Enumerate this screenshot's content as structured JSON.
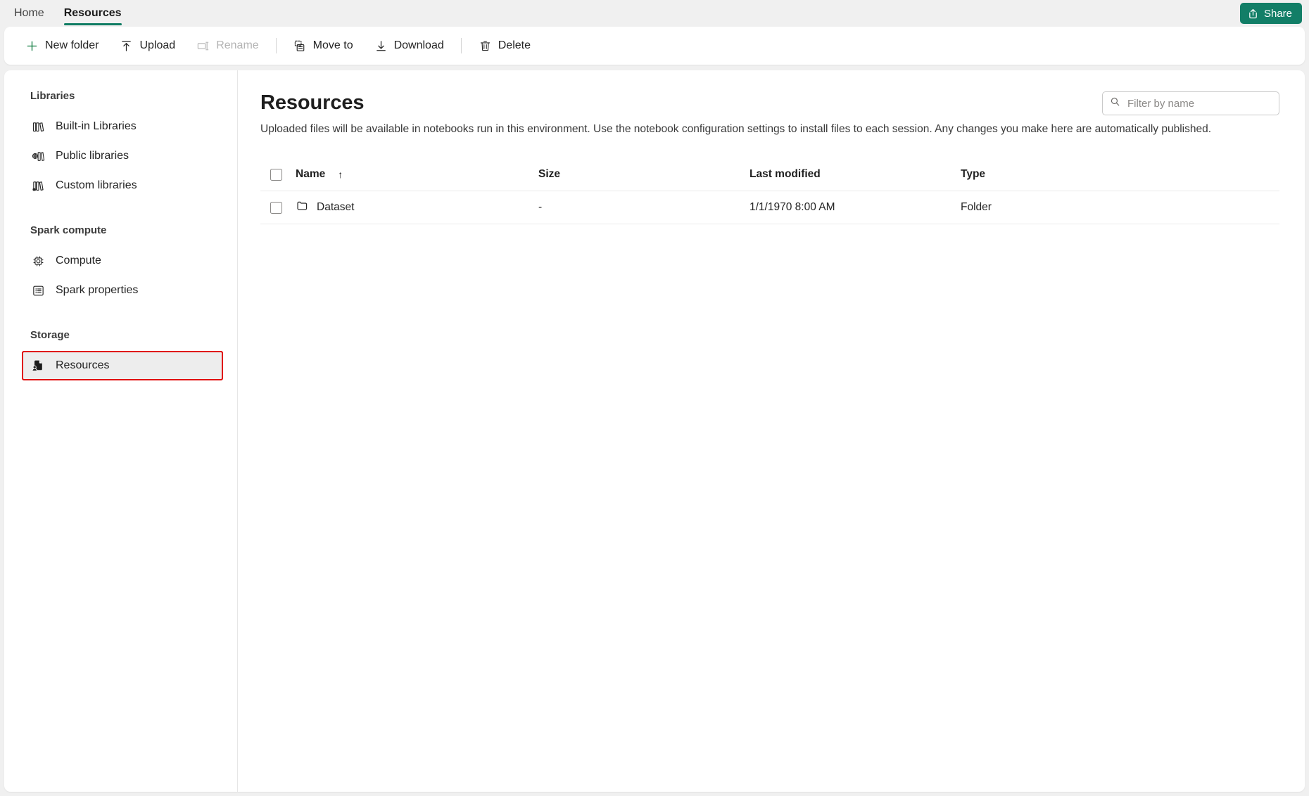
{
  "tabs": [
    {
      "label": "Home",
      "active": false
    },
    {
      "label": "Resources",
      "active": true
    }
  ],
  "share": {
    "label": "Share",
    "icon": "share-icon",
    "color": "#127e67"
  },
  "toolbar": {
    "new_folder": {
      "label": "New folder",
      "icon": "plus-icon",
      "disabled": false
    },
    "upload": {
      "label": "Upload",
      "icon": "upload-icon",
      "disabled": false
    },
    "rename": {
      "label": "Rename",
      "icon": "rename-icon",
      "disabled": true
    },
    "move_to": {
      "label": "Move to",
      "icon": "move-to-icon",
      "disabled": false
    },
    "download": {
      "label": "Download",
      "icon": "download-icon",
      "disabled": false
    },
    "delete": {
      "label": "Delete",
      "icon": "trash-icon",
      "disabled": false
    }
  },
  "sidebar": {
    "groups": [
      {
        "title": "Libraries",
        "items": [
          {
            "label": "Built-in Libraries",
            "icon": "books-icon",
            "selected": false
          },
          {
            "label": "Public libraries",
            "icon": "public-books-icon",
            "selected": false
          },
          {
            "label": "Custom libraries",
            "icon": "custom-books-icon",
            "selected": false
          }
        ]
      },
      {
        "title": "Spark compute",
        "items": [
          {
            "label": "Compute",
            "icon": "chip-icon",
            "selected": false
          },
          {
            "label": "Spark properties",
            "icon": "list-icon",
            "selected": false
          }
        ]
      },
      {
        "title": "Storage",
        "items": [
          {
            "label": "Resources",
            "icon": "resources-icon",
            "selected": true
          }
        ]
      }
    ]
  },
  "main": {
    "title": "Resources",
    "description": "Uploaded files will be available in notebooks run in this environment. Use the notebook configuration settings to install files to each session. Any changes you make here are automatically published.",
    "filter": {
      "placeholder": "Filter by name",
      "value": "",
      "icon": "search-icon"
    },
    "table": {
      "columns": [
        {
          "label": "Name",
          "sort": "↑"
        },
        {
          "label": "Size",
          "sort": ""
        },
        {
          "label": "Last modified",
          "sort": ""
        },
        {
          "label": "Type",
          "sort": ""
        }
      ],
      "rows": [
        {
          "name": "Dataset",
          "icon": "folder-icon",
          "size": "-",
          "last_modified": "1/1/1970 8:00 AM",
          "type": "Folder",
          "selected": false
        }
      ]
    }
  },
  "highlight": {
    "color": "#e00000",
    "target": "sidebar-item-resources"
  }
}
